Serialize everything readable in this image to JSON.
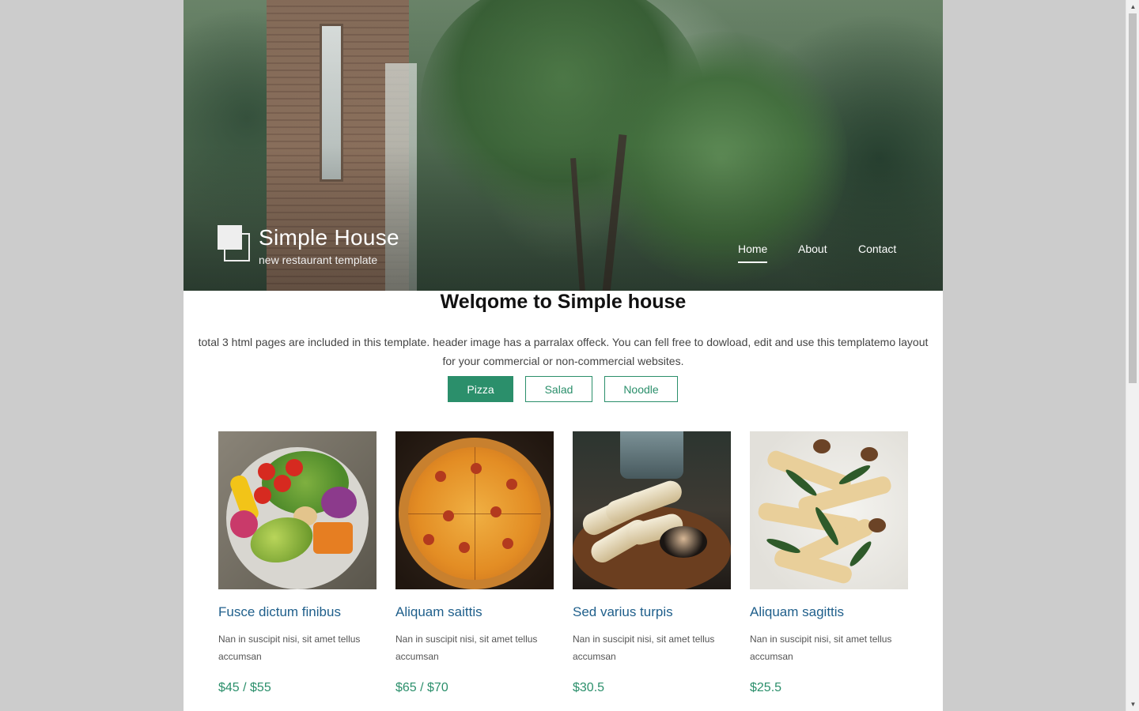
{
  "brand": {
    "title": "Simple House",
    "subtitle": "new restaurant template"
  },
  "nav": {
    "items": [
      {
        "label": "Home",
        "active": true
      },
      {
        "label": "About",
        "active": false
      },
      {
        "label": "Contact",
        "active": false
      }
    ]
  },
  "welcome": {
    "title": "Welqome to Simple house",
    "intro": "total 3 html pages are included in this template. header image has a parralax offeck. You can fell free to dowload, edit and use this templatemo layout for your commercial or non-commercial websites."
  },
  "filters": [
    {
      "label": "Pizza",
      "active": true
    },
    {
      "label": "Salad",
      "active": false
    },
    {
      "label": "Noodle",
      "active": false
    }
  ],
  "menu_items": [
    {
      "image": "salad-bowl",
      "title": "Fusce dictum finibus",
      "description": "Nan in suscipit nisi, sit amet tellus accumsan",
      "price": "$45 / $55"
    },
    {
      "image": "pizza",
      "title": "Aliquam saittis",
      "description": "Nan in suscipit nisi, sit amet tellus accumsan",
      "price": "$65 / $70"
    },
    {
      "image": "grilled-rolls",
      "title": "Sed varius turpis",
      "description": "Nan in suscipit nisi, sit amet tellus accumsan",
      "price": "$30.5"
    },
    {
      "image": "pasta",
      "title": "Aliquam sagittis",
      "description": "Nan in suscipit nisi, sit amet tellus accumsan",
      "price": "$25.5"
    }
  ],
  "colors": {
    "accent": "#2b8f6b",
    "title_link": "#1f5f8b",
    "page_bg": "#cccccc"
  }
}
